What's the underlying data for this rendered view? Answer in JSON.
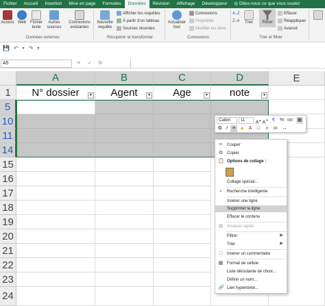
{
  "ribbon_tabs": [
    "Fichier",
    "Accueil",
    "Insertion",
    "Mise en page",
    "Formules",
    "Données",
    "Révision",
    "Affichage",
    "Développeur",
    "Dites-nous ce que vous voulez"
  ],
  "active_tab": "Données",
  "ribbon": {
    "access": "Access",
    "web": "Web",
    "fichier_texte": "Fichier texte",
    "autres_sources": "Autres sources",
    "connexions_existantes": "Connexions existantes",
    "nouvelle_requete": "Nouvelle requête",
    "afficher_requetes": "Afficher les requêtes",
    "a_partir_tableau": "À partir d'un tableau",
    "sources_recentes": "Sources récentes",
    "actualiser_tout": "Actualiser tout",
    "connexions": "Connexions",
    "proprietes": "Propriétés",
    "modifier_liens": "Modifier les liens",
    "trier": "Trier",
    "filtrer": "Filtrer",
    "effacer": "Effacer",
    "reappliquer": "Réappliquer",
    "avance": "Avancé",
    "groups": {
      "donnees_externes": "Données externes",
      "recuperer": "Récupérer et transformer",
      "connexions": "Connexions",
      "trier_filtrer": "Trier et filtrer"
    }
  },
  "name_box": "A5",
  "columns": [
    "A",
    "B",
    "C",
    "D",
    "E"
  ],
  "rows": [
    "1",
    "5",
    "10",
    "11",
    "14",
    "15",
    "16",
    "17",
    "18",
    "19",
    "20",
    "21",
    "22",
    "23",
    "24"
  ],
  "headers": {
    "a": "N° dossier",
    "b": "Agent",
    "c": "Age",
    "d": "note"
  },
  "mini_toolbar": {
    "font": "Calibri",
    "size": "11",
    "bold": "G",
    "italic": "I",
    "percent": "%",
    "thousands": "000"
  },
  "context_menu": {
    "couper": "Couper",
    "copier": "Copier",
    "options_collage": "Options de collage :",
    "collage_special": "Collage spécial...",
    "recherche": "Recherche intelligente",
    "inserer_ligne": "Insérer une ligne",
    "supprimer_ligne": "Supprimer la ligne",
    "effacer_contenu": "Effacer le contenu",
    "analyse_rapide": "Analyse rapide",
    "filtrer": "Filtrer",
    "trier": "Trier",
    "inserer_commentaire": "Insérer un commentaire",
    "format_cellule": "Format de cellule",
    "liste_deroulante": "Liste déroulante de choix...",
    "definir_nom": "Définir un nom...",
    "lien": "Lien hypertexte..."
  },
  "colors": {
    "excel_green": "#217346",
    "selection_fill": "#c6c6c6",
    "highlight": "#d3d3d3"
  }
}
